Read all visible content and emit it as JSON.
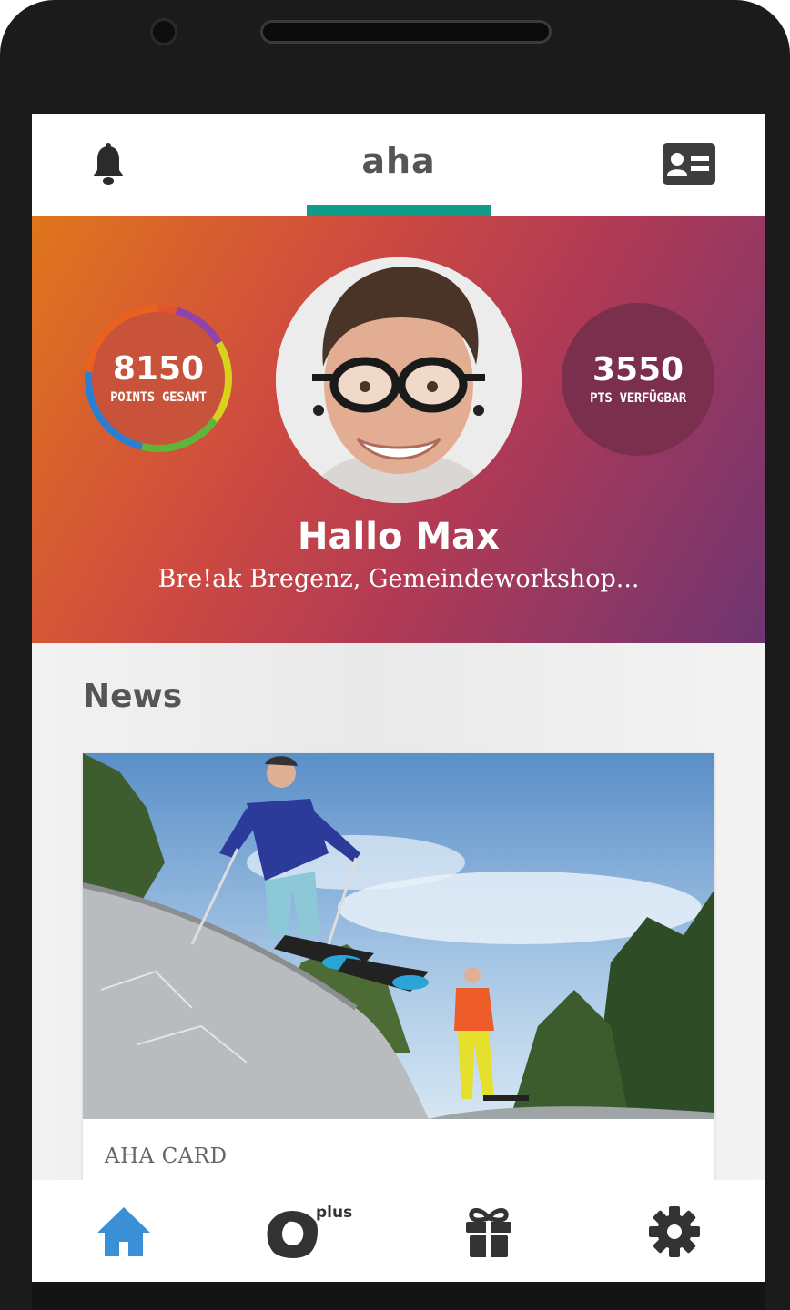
{
  "header": {
    "title": "aha",
    "icons": [
      "bell-icon",
      "id-card-icon"
    ],
    "accent": "#0f9d8a"
  },
  "profile": {
    "points_total": "8150",
    "points_total_label": "POINTS GESAMT",
    "points_available": "3550",
    "points_available_label": "PTS VERFÜGBAR",
    "greeting": "Hallo Max",
    "activities": "Bre!ak Bregenz, Gemeindeworkshop..."
  },
  "news": {
    "title": "News",
    "items": [
      {
        "category": "AHA CARD"
      }
    ]
  },
  "bottom_nav": {
    "items": [
      {
        "icon": "home-icon",
        "active": true
      },
      {
        "icon": "plus-icon",
        "label": "plus"
      },
      {
        "icon": "gift-icon"
      },
      {
        "icon": "gear-icon"
      }
    ],
    "active_color": "#3a8fd6"
  }
}
